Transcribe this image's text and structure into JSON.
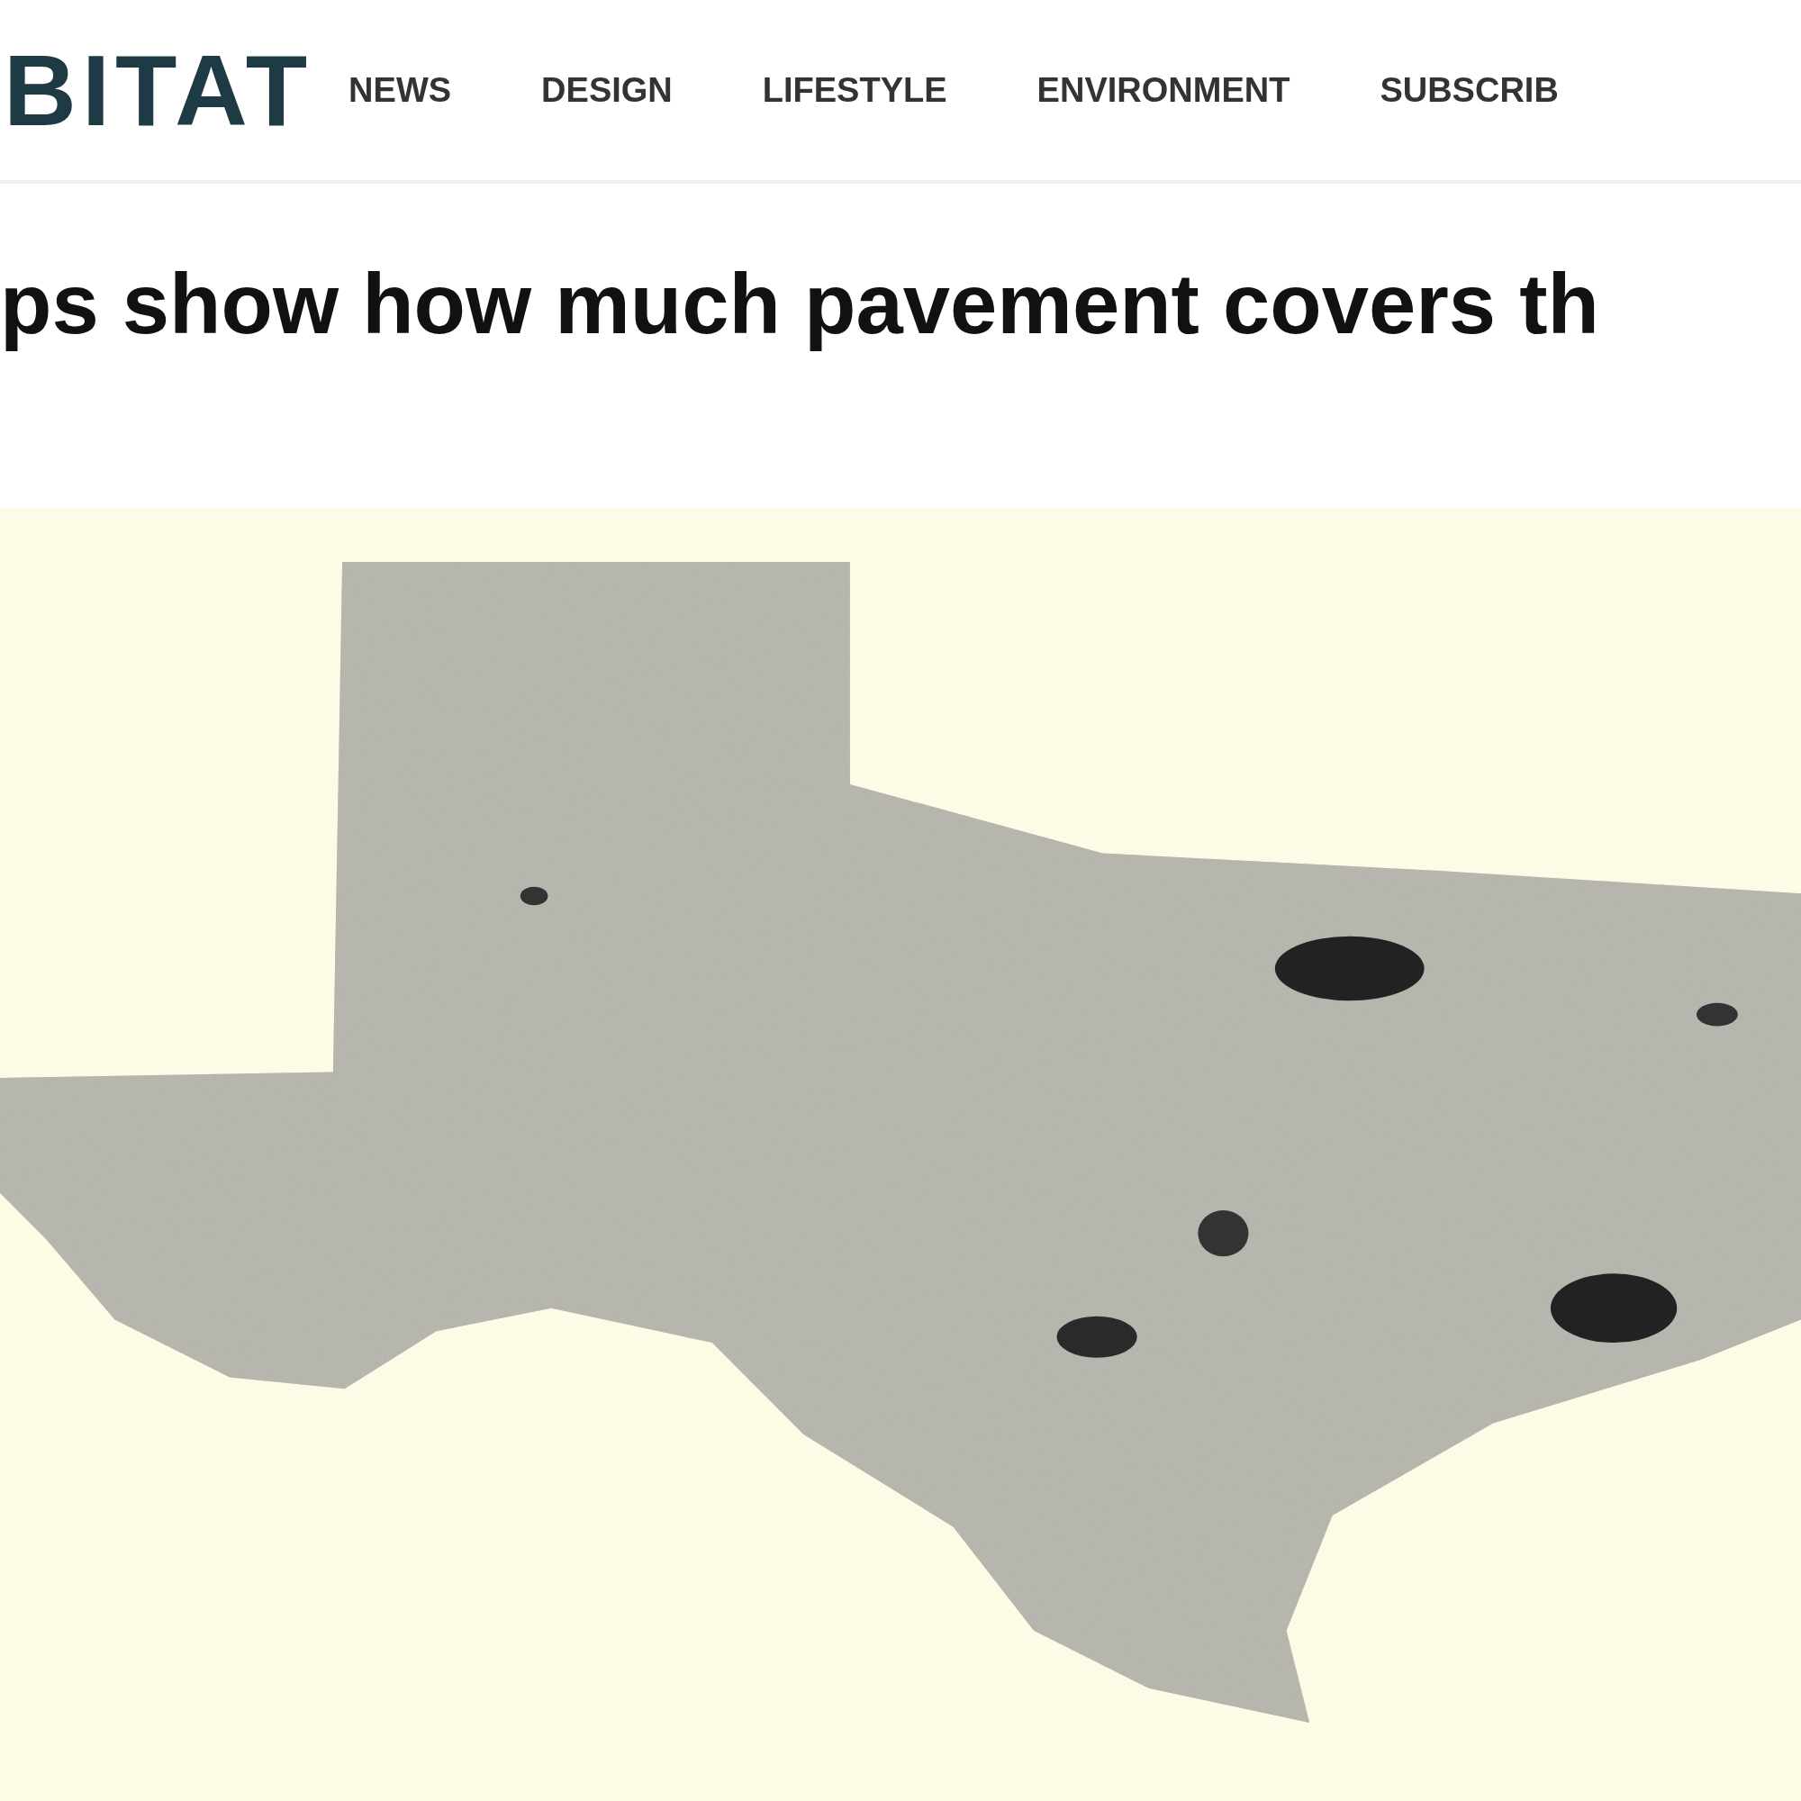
{
  "header": {
    "logo": "BITAT",
    "nav": [
      {
        "label": "NEWS"
      },
      {
        "label": "DESIGN"
      },
      {
        "label": "LIFESTYLE"
      },
      {
        "label": "ENVIRONMENT"
      },
      {
        "label": "SUBSCRIB"
      }
    ]
  },
  "article": {
    "headline": "ps show how much pavement covers th"
  }
}
